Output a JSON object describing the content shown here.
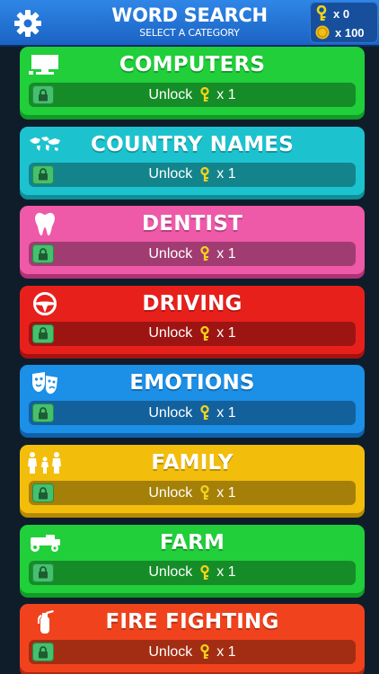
{
  "header": {
    "title": "WORD SEARCH",
    "subtitle": "SELECT A CATEGORY",
    "settings_icon": "gear-icon",
    "keys_count": "x 0",
    "coins_count": "x 100"
  },
  "colors": {
    "header": "#2176dd",
    "background": "#0f1d2b",
    "key": "#f3d21a",
    "coin": "#f2c014",
    "lock": "#45c06c"
  },
  "categories": [
    {
      "name": "COMPUTERS",
      "icon": "computer-icon",
      "color": "#20cf3a",
      "shadow": "#139a27",
      "unlock_label": "Unlock",
      "cost": "x 1"
    },
    {
      "name": "COUNTRY NAMES",
      "icon": "world-map-icon",
      "color": "#1cc3cf",
      "shadow": "#0f8e98",
      "unlock_label": "Unlock",
      "cost": "x 1"
    },
    {
      "name": "DENTIST",
      "icon": "tooth-icon",
      "color": "#ee59a8",
      "shadow": "#b03277",
      "unlock_label": "Unlock",
      "cost": "x 1"
    },
    {
      "name": "DRIVING",
      "icon": "steering-wheel-icon",
      "color": "#e8201c",
      "shadow": "#a5120f",
      "unlock_label": "Unlock",
      "cost": "x 1"
    },
    {
      "name": "EMOTIONS",
      "icon": "theater-masks-icon",
      "color": "#1c8fe6",
      "shadow": "#0f61a7",
      "unlock_label": "Unlock",
      "cost": "x 1"
    },
    {
      "name": "FAMILY",
      "icon": "family-icon",
      "color": "#f3bd0c",
      "shadow": "#b68a00",
      "unlock_label": "Unlock",
      "cost": "x 1"
    },
    {
      "name": "FARM",
      "icon": "tractor-icon",
      "color": "#20cf3a",
      "shadow": "#139a27",
      "unlock_label": "Unlock",
      "cost": "x 1"
    },
    {
      "name": "FIRE FIGHTING",
      "icon": "fire-extinguisher-icon",
      "color": "#f0431d",
      "shadow": "#b02810",
      "unlock_label": "Unlock",
      "cost": "x 1"
    }
  ]
}
